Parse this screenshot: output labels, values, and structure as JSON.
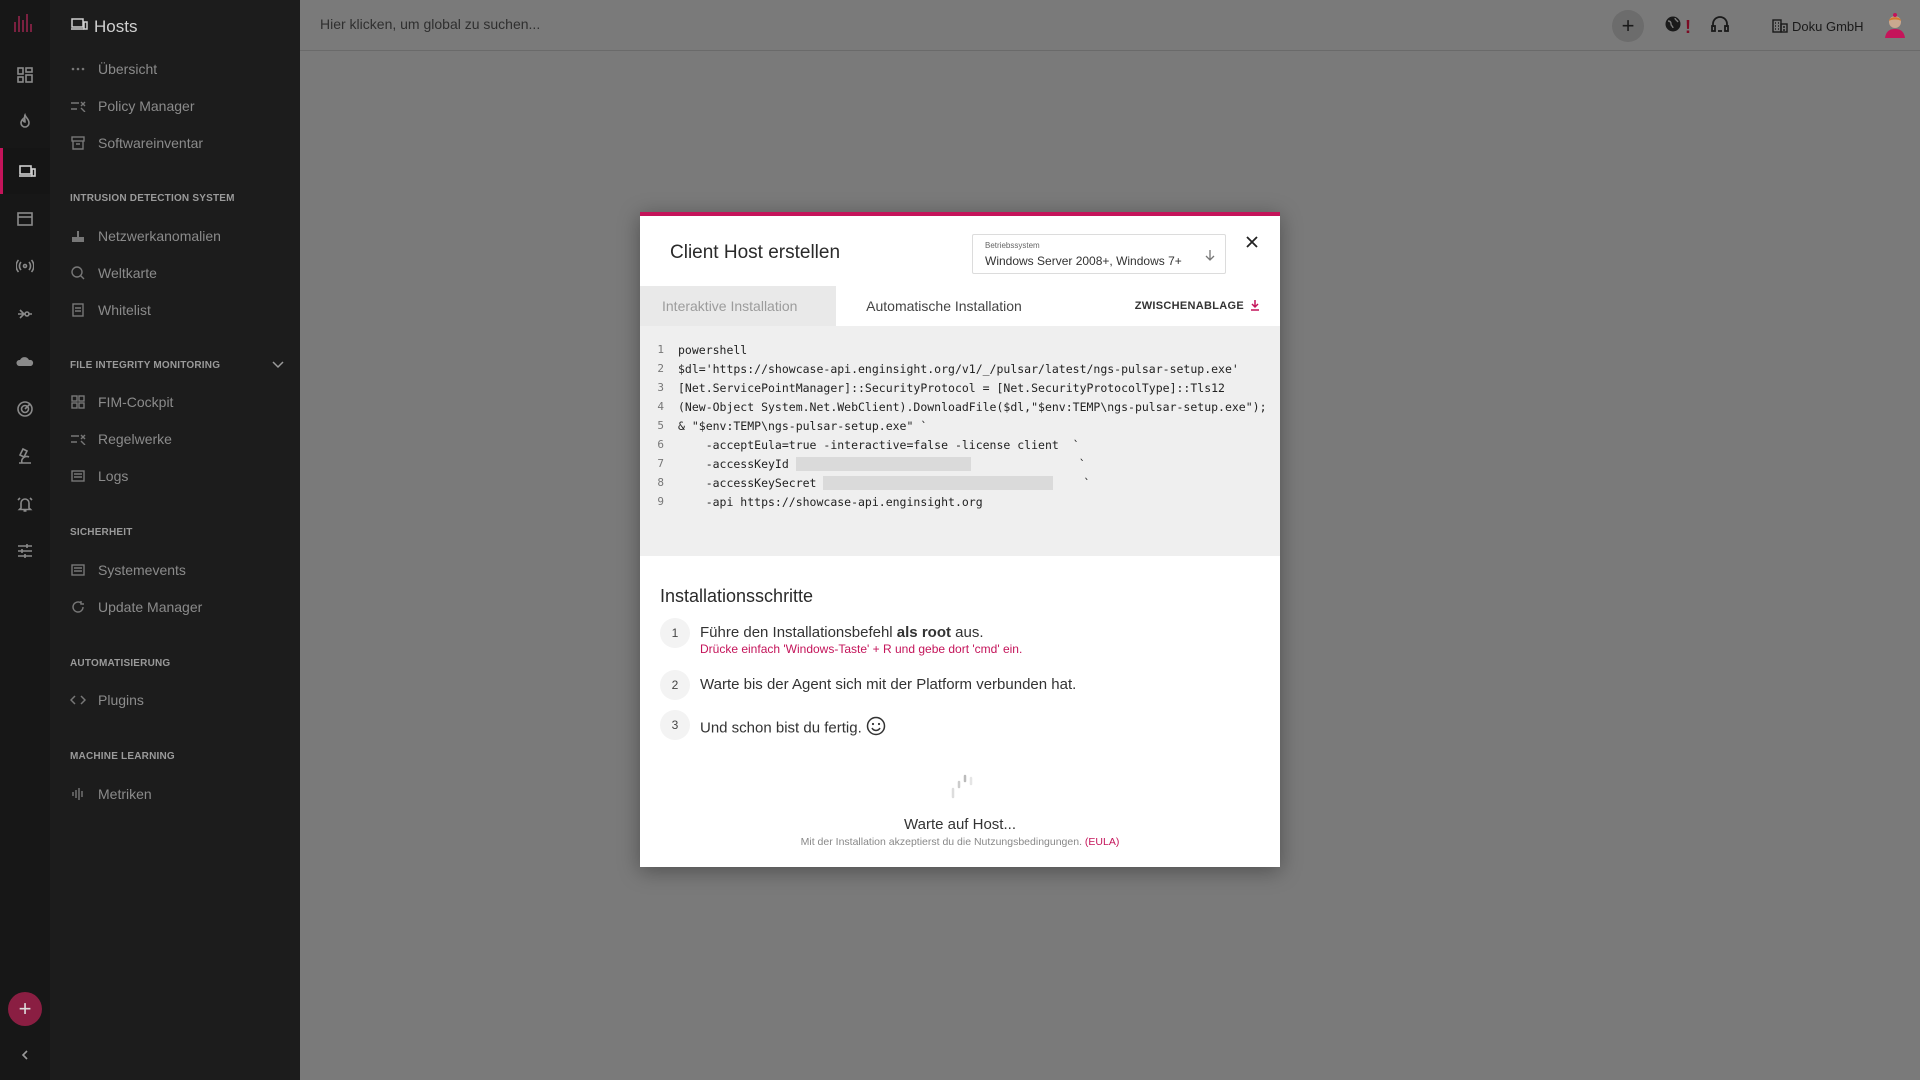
{
  "icons": {
    "rail": [
      "dashboard-icon",
      "fire-icon",
      "hosts-icon",
      "window-icon",
      "radio-waves-icon",
      "network-icon",
      "cloud-icon",
      "radar-icon",
      "microscope-icon",
      "alarm-bell-icon",
      "sliders-icon"
    ],
    "add": "+",
    "collapse": "chevron-left-icon"
  },
  "sidebar": {
    "title": "Hosts",
    "items_top": [
      "Übersicht",
      "Policy Manager",
      "Softwareinventar"
    ],
    "sections": [
      {
        "title": "INTRUSION DETECTION SYSTEM",
        "items": [
          "Netzwerkanomalien",
          "Weltkarte",
          "Whitelist"
        ]
      },
      {
        "title": "FILE INTEGRITY MONITORING",
        "items": [
          "FIM-Cockpit",
          "Regelwerke",
          "Logs"
        ]
      },
      {
        "title": "SICHERHEIT",
        "items": [
          "Systemevents",
          "Update Manager"
        ]
      },
      {
        "title": "AUTOMATISIERUNG",
        "items": [
          "Plugins"
        ]
      },
      {
        "title": "MACHINE LEARNING",
        "items": [
          "Metriken"
        ]
      }
    ]
  },
  "topbar": {
    "search_placeholder": "Hier klicken, um global zu suchen...",
    "alert_mark": "!",
    "org_name": "Doku GmbH"
  },
  "modal": {
    "title": "Client Host erstellen",
    "os_label": "Betriebssystem",
    "os_value": "Windows Server 2008+, Windows 7+",
    "tabs": [
      "Interaktive Installation",
      "Automatische Installation"
    ],
    "clipboard_label": "ZWISCHENABLAGE",
    "code_lines": [
      {
        "n": "1",
        "text": "powershell"
      },
      {
        "n": "2",
        "text": "$dl='https://showcase-api.enginsight.org/v1/_/pulsar/latest/ngs-pulsar-setup.exe'"
      },
      {
        "n": "3",
        "text": "[Net.ServicePointManager]::SecurityProtocol = [Net.SecurityProtocolType]::Tls12"
      },
      {
        "n": "4",
        "text": "(New-Object System.Net.WebClient).DownloadFile($dl,\"$env:TEMP\\ngs-pulsar-setup.exe\");"
      },
      {
        "n": "5",
        "text": "& \"$env:TEMP\\ngs-pulsar-setup.exe\" `"
      },
      {
        "n": "6",
        "text": "    -acceptEula=true -interactive=false -license client  `"
      },
      {
        "n": "7",
        "text": "    -accessKeyId "
      },
      {
        "n": "8",
        "text": "    -accessKeySecret "
      },
      {
        "n": "9",
        "text": "    -api https://showcase-api.enginsight.org"
      }
    ],
    "backtick": "`",
    "steps_title": "Installationsschritte",
    "steps": [
      {
        "num": "1",
        "text_before": "Führe den Installationsbefehl ",
        "bold": "als root",
        "text_after": " aus.",
        "hint": "Drücke einfach 'Windows-Taste' + R und gebe dort 'cmd' ein."
      },
      {
        "num": "2",
        "text": "Warte bis der Agent sich mit der Platform verbunden hat."
      },
      {
        "num": "3",
        "text": "Und schon bist du fertig."
      }
    ],
    "waiting": "Warte auf Host...",
    "eula_text": "Mit der Installation akzeptierst du die Nutzungsbedingungen.",
    "eula_link": "(EULA)"
  }
}
